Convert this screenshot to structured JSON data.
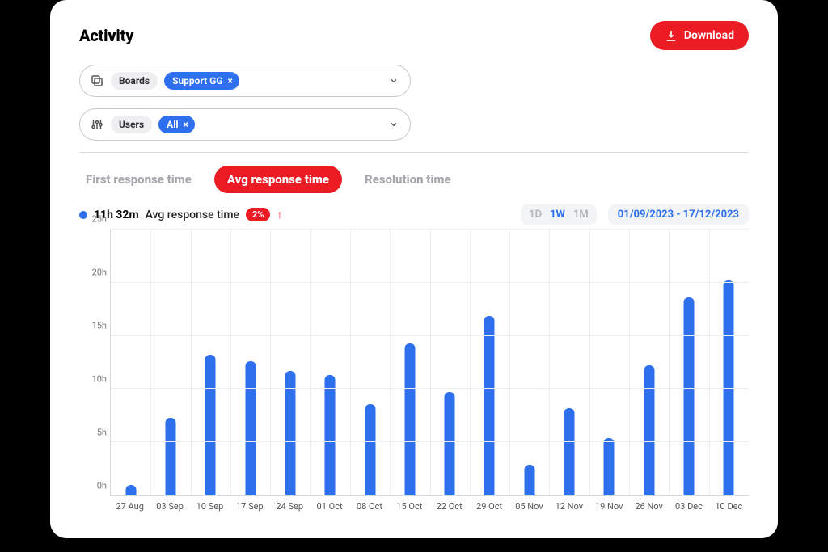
{
  "header": {
    "title": "Activity",
    "download": "Download"
  },
  "filters": {
    "boards": {
      "label": "Boards",
      "chip": "Support GG"
    },
    "users": {
      "label": "Users",
      "chip": "All"
    }
  },
  "tabs": {
    "first": "First response time",
    "avg": "Avg response time",
    "resolution": "Resolution time"
  },
  "metric": {
    "value": "11h 32m",
    "label": "Avg response time",
    "pct": "2%",
    "date_range": "01/09/2023 - 17/12/2023",
    "ranges": {
      "d": "1D",
      "w": "1W",
      "m": "1M"
    }
  },
  "chart_data": {
    "type": "bar",
    "title": "Avg response time",
    "xlabel": "",
    "ylabel": "",
    "ylim": [
      0,
      25
    ],
    "y_ticks": [
      "0h",
      "5h",
      "10h",
      "15h",
      "20h",
      "25h"
    ],
    "categories": [
      "27 Aug",
      "03 Sep",
      "10 Sep",
      "17 Sep",
      "24 Sep",
      "01 Oct",
      "08 Oct",
      "15 Oct",
      "22 Oct",
      "29 Oct",
      "05 Nov",
      "12 Nov",
      "19 Nov",
      "26 Nov",
      "03 Dec",
      "10 Dec"
    ],
    "values": [
      1.0,
      7.3,
      13.2,
      12.6,
      11.7,
      11.3,
      8.6,
      14.3,
      9.7,
      16.9,
      2.9,
      8.2,
      5.4,
      12.2,
      18.6,
      20.2
    ]
  }
}
